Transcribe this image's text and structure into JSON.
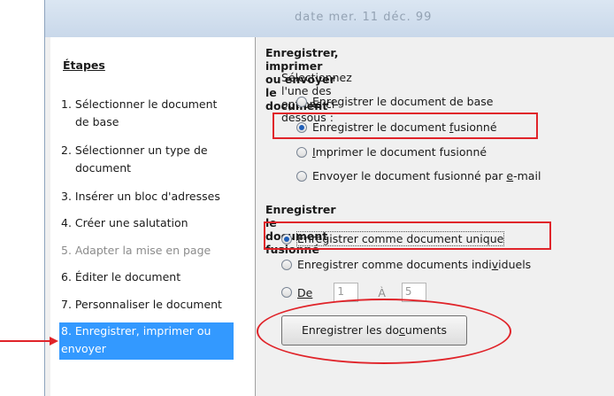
{
  "window": {
    "title": "date mer. 11 déc. 99"
  },
  "sidebar": {
    "heading": "Étapes",
    "steps": [
      {
        "label": "1. Sélectionner le document",
        "label2": "de base",
        "state": "enabled"
      },
      {
        "label": "2. Sélectionner un type de",
        "label2": "document",
        "state": "enabled"
      },
      {
        "label": "3. Insérer un bloc d'adresses",
        "state": "enabled"
      },
      {
        "label": "4. Créer une salutation",
        "state": "enabled"
      },
      {
        "label": "5. Adapter la mise en page",
        "state": "disabled"
      },
      {
        "label": "6. Éditer le document",
        "state": "enabled"
      },
      {
        "label": "7. Personnaliser le document",
        "state": "enabled"
      },
      {
        "label": "8. Enregistrer, imprimer ou",
        "label2": "envoyer",
        "state": "current"
      }
    ]
  },
  "main": {
    "section1_title": "Enregistrer, imprimer ou envoyer le document",
    "instructions": "Sélectionnez l'une des options ci-dessous :",
    "options": [
      {
        "before": "",
        "key": "E",
        "after": "nregistrer le document de base",
        "selected": false
      },
      {
        "before": "Enregistrer le document ",
        "key": "f",
        "after": "usionné",
        "selected": true
      },
      {
        "before": "",
        "key": "I",
        "after": "mprimer le document fusionné",
        "selected": false
      },
      {
        "before": "Envoyer le document fusionné par ",
        "key": "e",
        "after": "-mail",
        "selected": false
      }
    ],
    "section2_title": "Enregistrer le document fusionné",
    "save_modes": [
      {
        "label": "Enregistrer comme document unique",
        "selected": true
      },
      {
        "before": "Enregistrer comme documents indi",
        "key": "v",
        "after": "iduels",
        "selected": false
      }
    ],
    "range": {
      "from_label": "De",
      "from_value": "1",
      "to_label": "À",
      "to_value": "5",
      "selected": false
    },
    "save_button": {
      "before": "Enregistrer les do",
      "key": "c",
      "after": "uments"
    }
  },
  "colors": {
    "highlight": "#e0242a",
    "selection": "#3399ff",
    "annotation_arrow": "#e0242a"
  }
}
